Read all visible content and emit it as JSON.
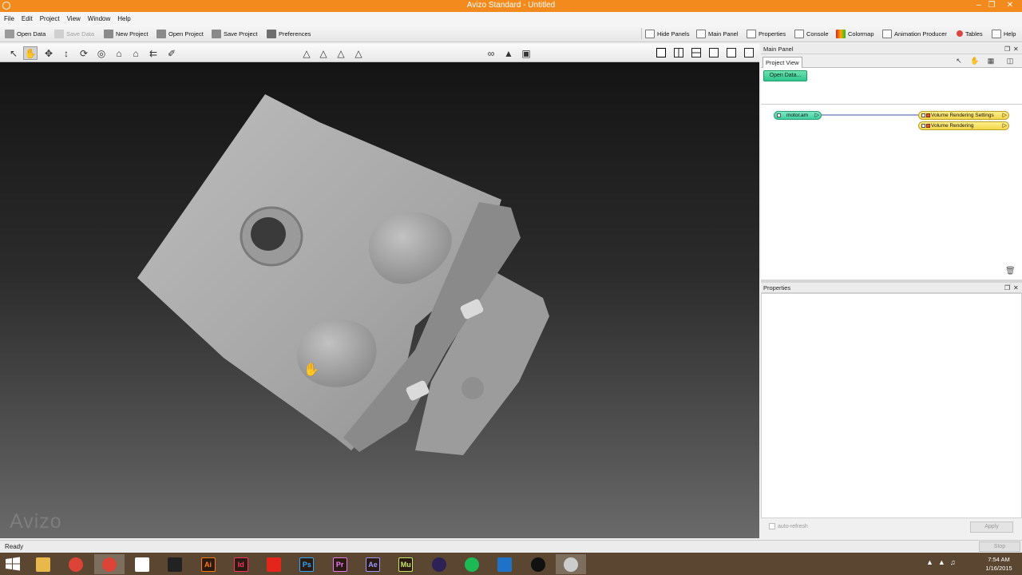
{
  "window": {
    "title": "Avizo Standard - Untitled"
  },
  "menu": [
    "File",
    "Edit",
    "Project",
    "View",
    "Window",
    "Help"
  ],
  "toolbar": {
    "open_data": "Open Data",
    "save_data": "Save Data",
    "new_project": "New Project",
    "open_project": "Open Project",
    "save_project": "Save Project",
    "preferences": "Preferences",
    "hide_panels": "Hide Panels",
    "main_panel": "Main Panel",
    "properties": "Properties",
    "console": "Console",
    "colormap": "Colormap",
    "animation_producer": "Animation Producer",
    "tables": "Tables",
    "help": "Help"
  },
  "viewer": {
    "watermark": "Avizo"
  },
  "main_panel": {
    "title": "Main Panel",
    "tab": "Project View",
    "open_data_button": "Open Data...",
    "nodes": {
      "data": "motor.am",
      "settings": "Volume Rendering Settings",
      "rendering": "Volume Rendering"
    }
  },
  "properties_panel": {
    "title": "Properties",
    "auto_refresh": "auto-refresh",
    "apply": "Apply"
  },
  "status": {
    "text": "Ready",
    "stop": "Stop"
  },
  "taskbar": {
    "apps": [
      {
        "name": "file-explorer",
        "label": "",
        "color": "#e8b84a"
      },
      {
        "name": "chrome",
        "label": "",
        "color": "#db4437"
      },
      {
        "name": "chrome-2",
        "label": "",
        "color": "#db4437"
      },
      {
        "name": "app-grid",
        "label": "",
        "color": "#ffffff"
      },
      {
        "name": "microscope",
        "label": "",
        "color": "#222222"
      },
      {
        "name": "illustrator",
        "label": "Ai",
        "color": "#ff7c00"
      },
      {
        "name": "indesign",
        "label": "Id",
        "color": "#ff3366"
      },
      {
        "name": "acrobat",
        "label": "",
        "color": "#e3251c"
      },
      {
        "name": "photoshop",
        "label": "Ps",
        "color": "#31a8ff"
      },
      {
        "name": "premiere",
        "label": "Pr",
        "color": "#ea77ff"
      },
      {
        "name": "after-effects",
        "label": "Ae",
        "color": "#9999ff"
      },
      {
        "name": "muse",
        "label": "Mu",
        "color": "#c5e86c"
      },
      {
        "name": "eclipse",
        "label": "",
        "color": "#2c2255"
      },
      {
        "name": "spotify",
        "label": "",
        "color": "#1db954"
      },
      {
        "name": "mail",
        "label": "",
        "color": "#1e73c8"
      },
      {
        "name": "obs",
        "label": "",
        "color": "#111111"
      },
      {
        "name": "avizo",
        "label": "",
        "color": "#cccccc"
      }
    ]
  },
  "clock": {
    "time": "7:54 AM",
    "date": "1/16/2015"
  }
}
